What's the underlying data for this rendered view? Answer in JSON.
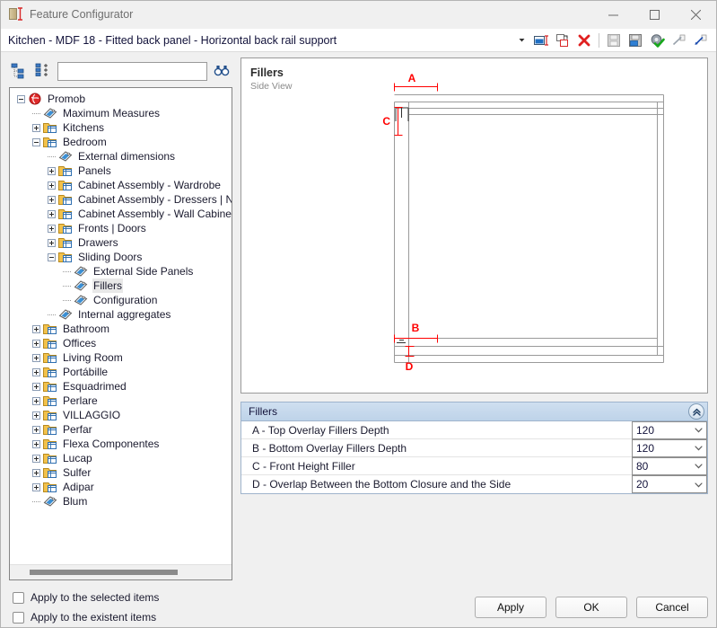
{
  "window": {
    "title": "Feature Configurator",
    "icon": "feature-configurator-icon",
    "minimize": "minimize-icon",
    "maximize": "maximize-icon",
    "close": "close-icon"
  },
  "pathbar": {
    "path": "Kitchen - MDF 18 - Fitted back panel - Horizontal back rail support",
    "dropdown_icon": "chevron-down-icon",
    "tools": [
      {
        "name": "rename-item-icon"
      },
      {
        "name": "copy-item-icon"
      },
      {
        "name": "delete-item-icon"
      },
      {
        "name": "save-icon"
      },
      {
        "name": "save-as-icon"
      },
      {
        "name": "settings-apply-icon"
      },
      {
        "name": "export-icon"
      },
      {
        "name": "import-icon"
      }
    ]
  },
  "tree_toolbar": {
    "collapse_all_icon": "collapse-tree-icon",
    "expand_all_icon": "expand-tree-icon",
    "search_value": "",
    "search_placeholder": "",
    "find_icon": "binoculars-icon"
  },
  "tree": {
    "selected": "Fillers",
    "items": [
      {
        "label": "Promob",
        "depth": 0,
        "icon": "promob-globe-icon",
        "state": "minus"
      },
      {
        "label": "Maximum Measures",
        "depth": 1,
        "icon": "tag-icon",
        "state": "leaf"
      },
      {
        "label": "Kitchens",
        "depth": 1,
        "icon": "folder-icon",
        "state": "plus"
      },
      {
        "label": "Bedroom",
        "depth": 1,
        "icon": "folder-icon",
        "state": "minus"
      },
      {
        "label": "External dimensions",
        "depth": 2,
        "icon": "tag-icon",
        "state": "leaf"
      },
      {
        "label": "Panels",
        "depth": 2,
        "icon": "folder-icon",
        "state": "plus"
      },
      {
        "label": "Cabinet Assembly - Wardrobe",
        "depth": 2,
        "icon": "folder-icon",
        "state": "plus"
      },
      {
        "label": "Cabinet Assembly - Dressers | Ni",
        "depth": 2,
        "icon": "folder-icon",
        "state": "plus"
      },
      {
        "label": "Cabinet Assembly - Wall Cabinet",
        "depth": 2,
        "icon": "folder-icon",
        "state": "plus"
      },
      {
        "label": "Fronts | Doors",
        "depth": 2,
        "icon": "folder-icon",
        "state": "plus"
      },
      {
        "label": "Drawers",
        "depth": 2,
        "icon": "folder-icon",
        "state": "plus"
      },
      {
        "label": "Sliding Doors",
        "depth": 2,
        "icon": "folder-icon",
        "state": "minus"
      },
      {
        "label": "External  Side Panels",
        "depth": 3,
        "icon": "tag-icon",
        "state": "leaf"
      },
      {
        "label": "Fillers",
        "depth": 3,
        "icon": "tag-icon",
        "state": "leaf"
      },
      {
        "label": "Configuration",
        "depth": 3,
        "icon": "tag-icon",
        "state": "leaf"
      },
      {
        "label": "Internal aggregates",
        "depth": 2,
        "icon": "tag-icon",
        "state": "leaf"
      },
      {
        "label": "Bathroom",
        "depth": 1,
        "icon": "folder-icon",
        "state": "plus"
      },
      {
        "label": "Offices",
        "depth": 1,
        "icon": "folder-icon",
        "state": "plus"
      },
      {
        "label": "Living Room",
        "depth": 1,
        "icon": "folder-icon",
        "state": "plus"
      },
      {
        "label": "Portábille",
        "depth": 1,
        "icon": "folder-icon",
        "state": "plus"
      },
      {
        "label": "Esquadrimed",
        "depth": 1,
        "icon": "folder-icon",
        "state": "plus"
      },
      {
        "label": "Perlare",
        "depth": 1,
        "icon": "folder-icon",
        "state": "plus"
      },
      {
        "label": "VILLAGGIO",
        "depth": 1,
        "icon": "folder-icon",
        "state": "plus"
      },
      {
        "label": "Perfar",
        "depth": 1,
        "icon": "folder-icon",
        "state": "plus"
      },
      {
        "label": "Flexa Componentes",
        "depth": 1,
        "icon": "folder-icon",
        "state": "plus"
      },
      {
        "label": "Lucap",
        "depth": 1,
        "icon": "folder-icon",
        "state": "plus"
      },
      {
        "label": "Sulfer",
        "depth": 1,
        "icon": "folder-icon",
        "state": "plus"
      },
      {
        "label": "Adipar",
        "depth": 1,
        "icon": "folder-icon",
        "state": "plus"
      },
      {
        "label": "Blum",
        "depth": 1,
        "icon": "tag-icon",
        "state": "leaf"
      }
    ]
  },
  "checkboxes": [
    {
      "label": "Apply to the selected items",
      "checked": false
    },
    {
      "label": "Apply to the existent items",
      "checked": false
    }
  ],
  "viewport": {
    "title": "Fillers",
    "subtitle": "Side View",
    "dimension_labels": [
      "A",
      "B",
      "C",
      "D"
    ],
    "accent_color": "#ff0000",
    "line_color": "#9a9a9a"
  },
  "properties": {
    "header": "Fillers",
    "collapse_icon": "double-chevron-up-icon",
    "rows": [
      {
        "label": "A - Top Overlay Fillers Depth",
        "value": "120",
        "chevron": "chevron-down-icon"
      },
      {
        "label": "B - Bottom Overlay Fillers Depth",
        "value": "120",
        "chevron": "chevron-down-icon"
      },
      {
        "label": "C - Front Height Filler",
        "value": "80",
        "chevron": "chevron-down-icon"
      },
      {
        "label": "D - Overlap Between the Bottom Closure and the Side",
        "value": "20",
        "chevron": "chevron-down-icon"
      }
    ]
  },
  "footer": {
    "apply": "Apply",
    "ok": "OK",
    "cancel": "Cancel"
  }
}
